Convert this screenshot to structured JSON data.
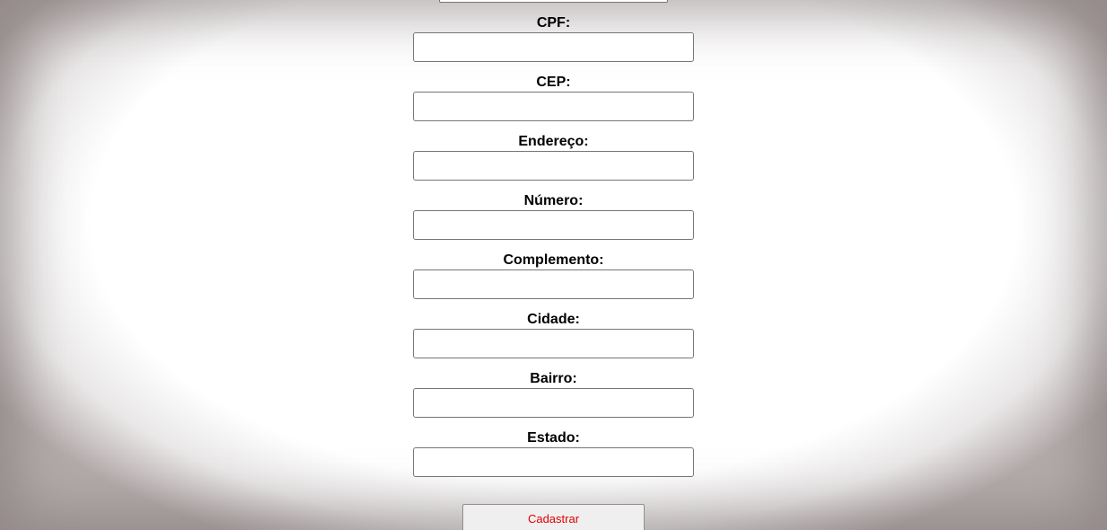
{
  "form": {
    "fields": [
      {
        "label": "CPF:",
        "value": ""
      },
      {
        "label": "CEP:",
        "value": ""
      },
      {
        "label": "Endereço:",
        "value": ""
      },
      {
        "label": "Número:",
        "value": ""
      },
      {
        "label": "Complemento:",
        "value": ""
      },
      {
        "label": "Cidade:",
        "value": ""
      },
      {
        "label": "Bairro:",
        "value": ""
      },
      {
        "label": "Estado:",
        "value": ""
      }
    ],
    "submit_label": "Cadastrar"
  },
  "colors": {
    "submit_text": "#e00000",
    "input_border": "#767676",
    "vignette": "#b3aaaa"
  }
}
